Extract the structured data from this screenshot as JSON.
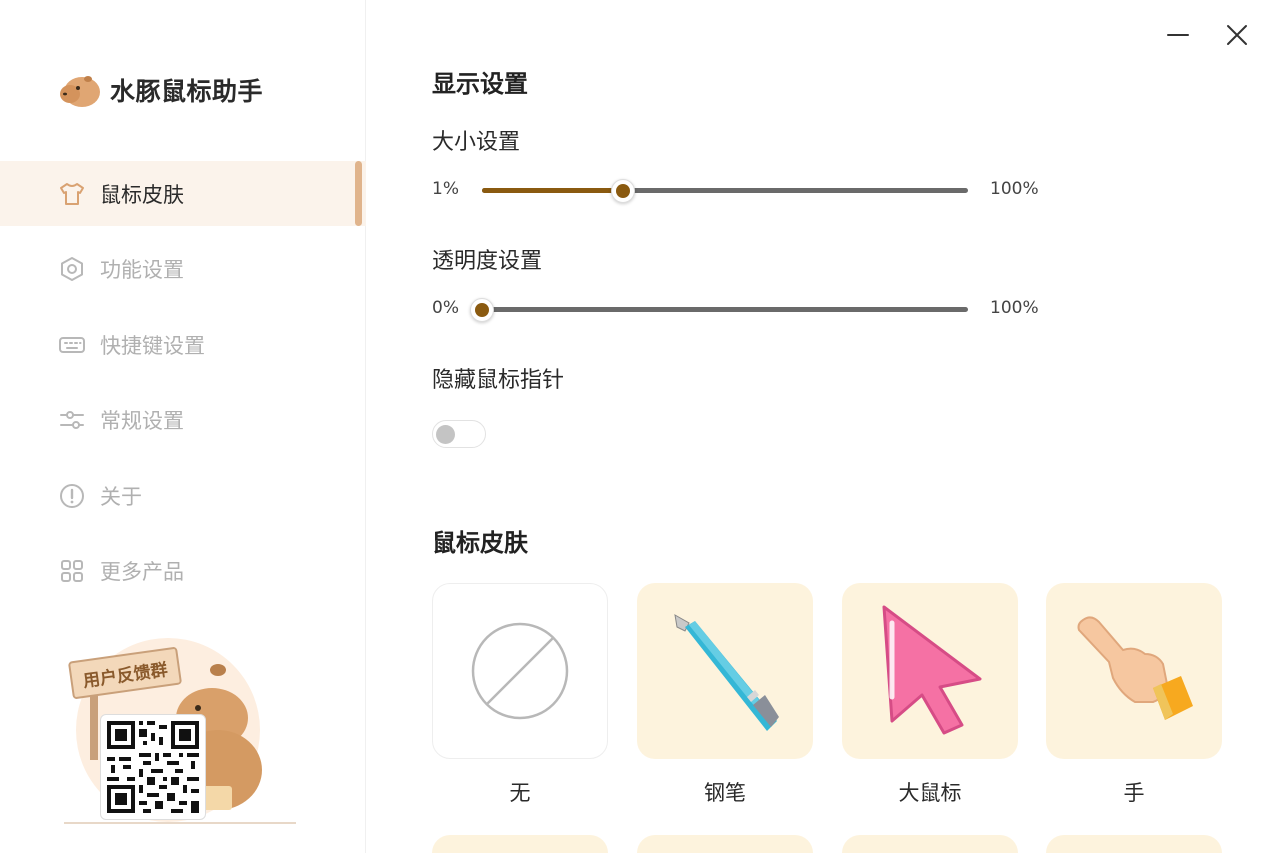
{
  "app": {
    "name": "水豚鼠标助手"
  },
  "sidebar": {
    "items": [
      {
        "label": "鼠标皮肤",
        "icon": "shirt-icon",
        "active": true
      },
      {
        "label": "功能设置",
        "icon": "hexagon-settings-icon",
        "active": false
      },
      {
        "label": "快捷键设置",
        "icon": "keyboard-icon",
        "active": false
      },
      {
        "label": "常规设置",
        "icon": "sliders-icon",
        "active": false
      },
      {
        "label": "关于",
        "icon": "info-icon",
        "active": false
      },
      {
        "label": "更多产品",
        "icon": "grid-icon",
        "active": false
      }
    ],
    "feedback_sign": "用户反馈群"
  },
  "window": {
    "minimize_icon": "minimize-icon",
    "close_icon": "close-icon"
  },
  "display": {
    "title": "显示设置",
    "size": {
      "label": "大小设置",
      "min": "1%",
      "max": "100%",
      "value_percent": 29
    },
    "opacity": {
      "label": "透明度设置",
      "min": "0%",
      "max": "100%",
      "value_percent": 0
    },
    "hide_pointer": {
      "label": "隐藏鼠标指针",
      "enabled": false
    }
  },
  "skins": {
    "title": "鼠标皮肤",
    "items": [
      {
        "label": "无",
        "icon": "none-icon"
      },
      {
        "label": "钢笔",
        "icon": "fountain-pen-icon"
      },
      {
        "label": "大鼠标",
        "icon": "big-arrow-cursor-icon"
      },
      {
        "label": "手",
        "icon": "pointing-hand-icon"
      }
    ]
  },
  "colors": {
    "accent": "#8a5a10",
    "active_bg": "#fbf3eb",
    "indicator": "#e0b48c",
    "card_bg": "#fdf3dd"
  }
}
